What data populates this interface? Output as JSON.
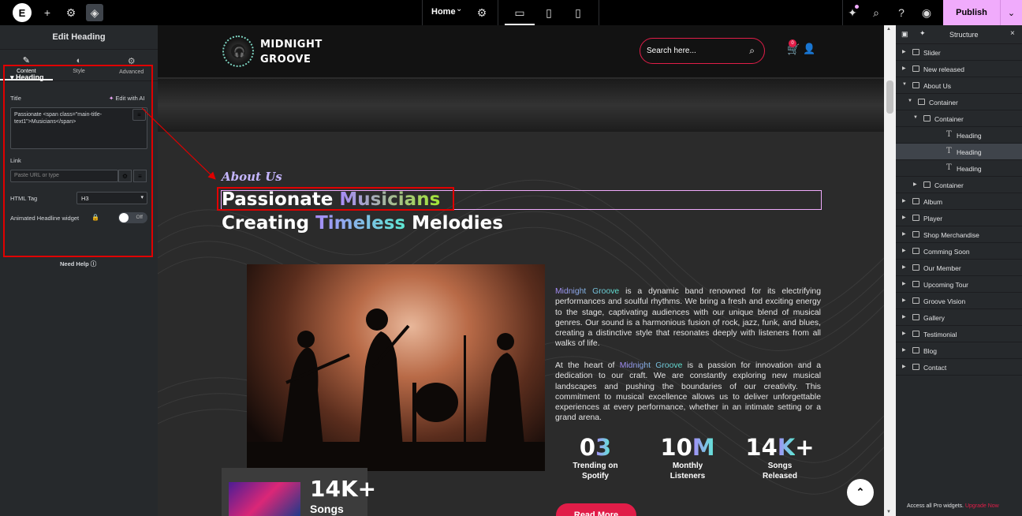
{
  "topbar": {
    "logo": "E",
    "page_select": "Home",
    "publish_label": "Publish"
  },
  "left_panel": {
    "title": "Edit Heading",
    "tabs": [
      {
        "label": "Content",
        "icon": "pencil-icon"
      },
      {
        "label": "Style",
        "icon": "half-circle-icon"
      },
      {
        "label": "Advanced",
        "icon": "gear-icon"
      }
    ],
    "section_label": "Heading",
    "title_label": "Title",
    "edit_ai_label": "Edit with AI",
    "title_value": "Passionate <span class=\"main-title-text1\">Musicians</span>",
    "link_label": "Link",
    "link_placeholder": "Paste URL or type",
    "html_tag_label": "HTML Tag",
    "html_tag_value": "H3",
    "animated_label": "Animated Headline widget",
    "toggle_value": "Off",
    "need_help": "Need Help"
  },
  "site": {
    "brand_line1": "MIDNIGHT",
    "brand_line2": "GROOVE",
    "search_placeholder": "Search here...",
    "cart_count": "0",
    "about_label": "About Us",
    "heading1_a": "Passionate ",
    "heading1_b": "Musicians",
    "heading2_a": "Creating ",
    "heading2_b": "Timeless",
    "heading2_c": " Melodies",
    "para1_brand": "Midnight Groove",
    "para1_rest": " is a dynamic band renowned for its electrifying performances and soulful rhythms. We bring a fresh and exciting energy to the stage, captivating audiences with our unique blend of musical genres. Our sound is a harmonious fusion of rock, jazz, funk, and blues, creating a distinctive style that resonates deeply with listeners from all walks of life.",
    "para2_a": "At the heart of ",
    "para2_brand": "Midnight Groove",
    "para2_rest": " is a passion for innovation and a dedication to our craft. We are constantly exploring new musical landscapes and pushing the boundaries of our creativity. This commitment to musical excellence allows us to deliver unforgettable experiences at every performance, whether in an intimate setting or a grand arena.",
    "stats": [
      {
        "num_a": "0",
        "num_b": "3",
        "label1": "Trending on",
        "label2": "Spotify"
      },
      {
        "num_a": "10",
        "num_b": "M",
        "label1": "Monthly",
        "label2": "Listeners"
      },
      {
        "num_a": "14",
        "num_b": "K",
        "num_c": "+",
        "label1": "Songs",
        "label2": "Released"
      }
    ],
    "mini_num": "14K+",
    "mini_label": "Songs",
    "read_more": "Read More"
  },
  "structure": {
    "title": "Structure",
    "items": [
      {
        "label": "Slider",
        "depth": 0,
        "kind": "container",
        "caret": "right"
      },
      {
        "label": "New released",
        "depth": 0,
        "kind": "container",
        "caret": "right"
      },
      {
        "label": "About Us",
        "depth": 0,
        "kind": "container",
        "caret": "down"
      },
      {
        "label": "Container",
        "depth": 1,
        "kind": "container",
        "caret": "down"
      },
      {
        "label": "Container",
        "depth": 2,
        "kind": "container",
        "caret": "down"
      },
      {
        "label": "Heading",
        "depth": 3,
        "kind": "heading",
        "caret": "none"
      },
      {
        "label": "Heading",
        "depth": 3,
        "kind": "heading",
        "caret": "none",
        "selected": true
      },
      {
        "label": "Heading",
        "depth": 3,
        "kind": "heading",
        "caret": "none"
      },
      {
        "label": "Container",
        "depth": 2,
        "kind": "container",
        "caret": "right"
      },
      {
        "label": "Album",
        "depth": 0,
        "kind": "container",
        "caret": "right"
      },
      {
        "label": "Player",
        "depth": 0,
        "kind": "container",
        "caret": "right"
      },
      {
        "label": "Shop Merchandise",
        "depth": 0,
        "kind": "container",
        "caret": "right"
      },
      {
        "label": "Comming Soon",
        "depth": 0,
        "kind": "container",
        "caret": "right"
      },
      {
        "label": "Our Member",
        "depth": 0,
        "kind": "container",
        "caret": "right"
      },
      {
        "label": "Upcoming Tour",
        "depth": 0,
        "kind": "container",
        "caret": "right"
      },
      {
        "label": "Groove Vision",
        "depth": 0,
        "kind": "container",
        "caret": "right"
      },
      {
        "label": "Gallery",
        "depth": 0,
        "kind": "container",
        "caret": "right"
      },
      {
        "label": "Testimonial",
        "depth": 0,
        "kind": "container",
        "caret": "right"
      },
      {
        "label": "Blog",
        "depth": 0,
        "kind": "container",
        "caret": "right"
      },
      {
        "label": "Contact",
        "depth": 0,
        "kind": "container",
        "caret": "right"
      }
    ],
    "pro_text": "Access all Pro widgets.",
    "pro_link": "Upgrade Now"
  },
  "colors": {
    "accent_pink": "#f0abfc",
    "brand_red": "#e11d48",
    "annotation_red": "#e00000"
  }
}
